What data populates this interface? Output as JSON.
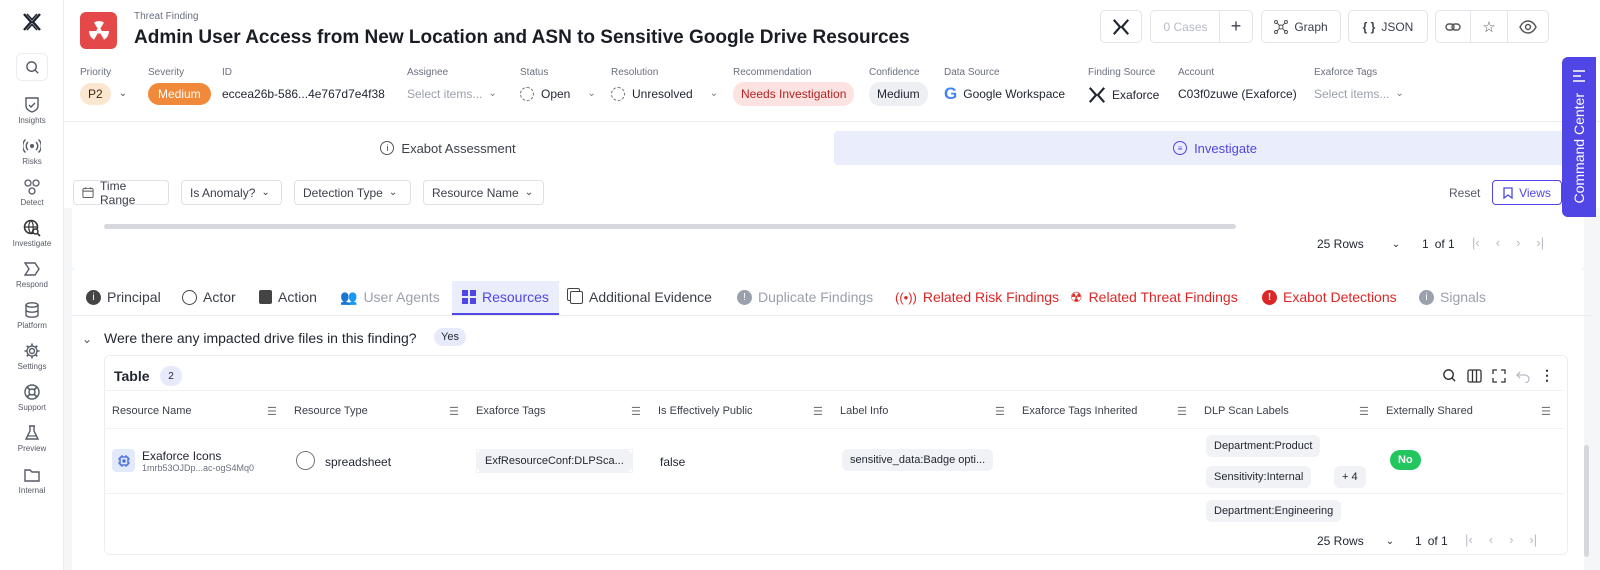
{
  "sidebar": {
    "items": [
      {
        "label": "Insights",
        "icon": "shield-check-icon"
      },
      {
        "label": "Risks",
        "icon": "radio-signal-icon"
      },
      {
        "label": "Detect",
        "icon": "radiation-icon"
      },
      {
        "label": "Investigate",
        "icon": "globe-search-icon"
      },
      {
        "label": "Respond",
        "icon": "chevron-flag-icon"
      },
      {
        "label": "Platform",
        "icon": "database-icon"
      },
      {
        "label": "Settings",
        "icon": "gear-icon"
      },
      {
        "label": "Support",
        "icon": "lifebuoy-icon"
      },
      {
        "label": "Preview",
        "icon": "flask-icon"
      },
      {
        "label": "Internal",
        "icon": "folder-icon"
      }
    ]
  },
  "header": {
    "kind": "Threat Finding",
    "title": "Admin User Access from New Location and ASN to Sensitive Google Drive Resources",
    "buttons": {
      "cases": "0 Cases",
      "graph": "Graph",
      "json": "JSON"
    },
    "fields": {
      "priority": {
        "label": "Priority",
        "value": "P2"
      },
      "severity": {
        "label": "Severity",
        "value": "Medium"
      },
      "id": {
        "label": "ID",
        "value": "eccea26b-586...4e767d7e4f38"
      },
      "assignee": {
        "label": "Assignee",
        "placeholder": "Select items..."
      },
      "status": {
        "label": "Status",
        "value": "Open"
      },
      "resolution": {
        "label": "Resolution",
        "value": "Unresolved"
      },
      "recommendation": {
        "label": "Recommendation",
        "value": "Needs Investigation"
      },
      "confidence": {
        "label": "Confidence",
        "value": "Medium"
      },
      "data_source": {
        "label": "Data Source",
        "value": "Google Workspace"
      },
      "finding_source": {
        "label": "Finding Source",
        "value": "Exaforce"
      },
      "account": {
        "label": "Account",
        "value": "C03f0zuwe (Exaforce)"
      },
      "tags": {
        "label": "Exaforce Tags",
        "placeholder": "Select items..."
      }
    }
  },
  "command_center": "Command Center",
  "main_tabs": [
    {
      "label": "Exabot Assessment",
      "active": false
    },
    {
      "label": "Investigate",
      "active": true
    }
  ],
  "filters": {
    "time_range": "Time Range",
    "is_anomaly": "Is Anomaly?",
    "detection_type": "Detection Type",
    "resource_name": "Resource Name",
    "reset": "Reset",
    "views": "Views"
  },
  "pagination_top": {
    "rows": "25 Rows",
    "page": "1",
    "of": "of 1"
  },
  "sub_tabs": [
    {
      "label": "Principal",
      "state": "normal"
    },
    {
      "label": "Actor",
      "state": "normal"
    },
    {
      "label": "Action",
      "state": "normal"
    },
    {
      "label": "User Agents",
      "state": "disabled"
    },
    {
      "label": "Resources",
      "state": "active"
    },
    {
      "label": "Additional Evidence",
      "state": "normal"
    },
    {
      "label": "Duplicate Findings",
      "state": "disabled"
    },
    {
      "label": "Related Risk Findings",
      "state": "alert"
    },
    {
      "label": "Related Threat Findings",
      "state": "alert"
    },
    {
      "label": "Exabot Detections",
      "state": "alert"
    },
    {
      "label": "Signals",
      "state": "disabled"
    }
  ],
  "question": {
    "text": "Were there any impacted drive files in this finding?",
    "answer": "Yes"
  },
  "table": {
    "title": "Table",
    "count": "2",
    "columns": [
      "Resource Name",
      "Resource Type",
      "Exaforce Tags",
      "Is Effectively Public",
      "Label Info",
      "Exaforce Tags Inherited",
      "DLP Scan Labels",
      "Externally Shared"
    ],
    "rows": [
      {
        "name": "Exaforce Icons",
        "id": "1mrb53OJDp...ac-ogS4Mq0",
        "type": "spreadsheet",
        "tags": "ExfResourceConf:DLPSca...",
        "public": "false",
        "label_info": "sensitive_data:Badge opti...",
        "dlp": [
          "Department:Product",
          "Sensitivity:Internal"
        ],
        "dlp_more": "+ 4",
        "shared": "No"
      }
    ],
    "row2_dlp": "Department:Engineering",
    "pagination": {
      "rows": "25 Rows",
      "page": "1",
      "of": "of 1"
    }
  },
  "colors": {
    "accent": "#4f46e5",
    "alert": "#dc2626",
    "severity": "#f0893a",
    "success": "#22c55e"
  }
}
